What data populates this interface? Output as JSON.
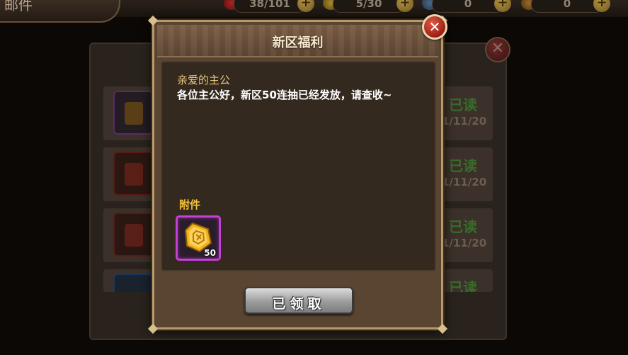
{
  "background": {
    "screen_title": "邮件",
    "resources": [
      {
        "value": "38/101",
        "icon": "heart-icon"
      },
      {
        "value": "5/30",
        "icon": "lightning-icon"
      },
      {
        "value": "0",
        "icon": "gem-icon"
      },
      {
        "value": "0",
        "icon": "coin-icon"
      }
    ],
    "mail_rows": [
      {
        "status": "已读",
        "date": "1/11/20"
      },
      {
        "status": "已读",
        "date": "1/11/20"
      },
      {
        "status": "已读",
        "date": "1/11/20"
      },
      {
        "status": "已读",
        "date": ""
      }
    ]
  },
  "dialog": {
    "title": "新区福利",
    "greeting": "亲爱的主公",
    "message": "各位主公好，新区50连抽已经发放，请查收~",
    "attachment_label": "附件",
    "attachment": {
      "count": "50",
      "icon": "summon-token-icon",
      "rarity_color": "#c53fd8"
    },
    "claim_button": "已领取"
  },
  "colors": {
    "accent_gold": "#f3c33a",
    "close_red": "#c2342a",
    "status_green": "#3a6b2c"
  }
}
